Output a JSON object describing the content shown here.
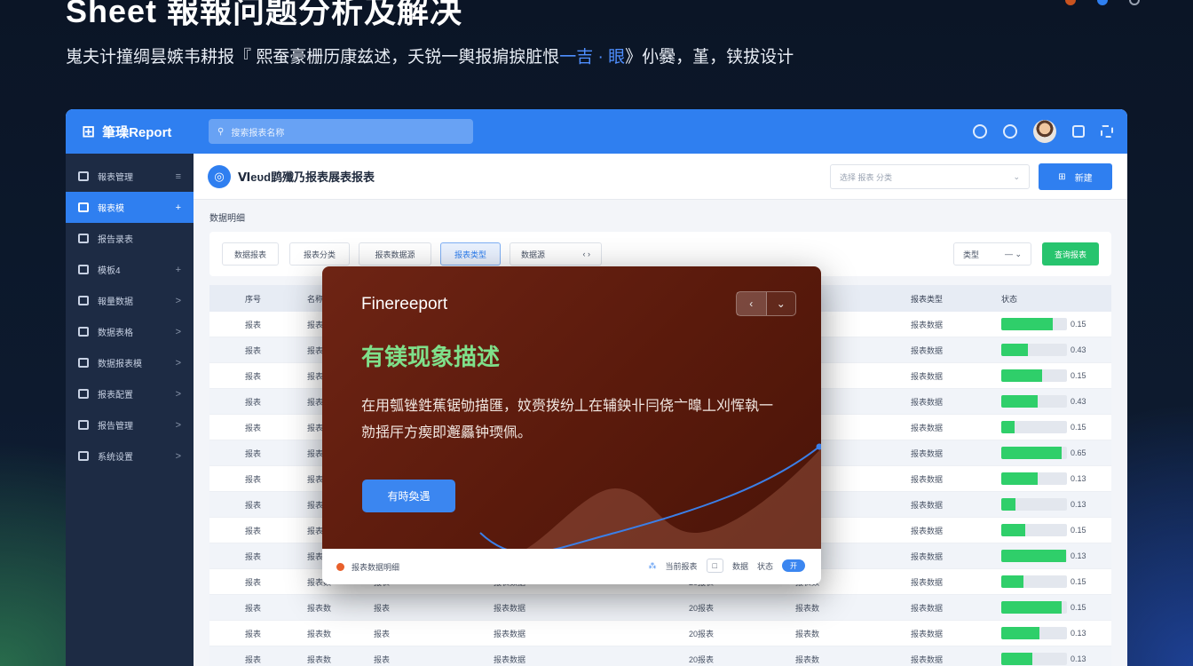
{
  "hero": {
    "title": "Sheet 報報问题分析及解决",
    "subtitle_main": "嵬夫计撞绸昙嫉韦耕报『 熙蚕豪栅历康兹述，夭锐一輿报掮捩脏恨",
    "subtitle_hl": "一吉 · 眼",
    "subtitle_end": "》仦爨，堇，铗拔设计"
  },
  "app": {
    "logo_icon": "grid-logo-icon",
    "logo_text": "筆璪Report",
    "search_placeholder": "搜索报表名称",
    "header_icons": [
      "settings-icon",
      "target-icon",
      "avatar",
      "message-icon",
      "expand-icon"
    ]
  },
  "sidebar": {
    "items": [
      {
        "label": "報表管理",
        "arrow": "≡"
      },
      {
        "label": "報表模",
        "arrow": "+"
      },
      {
        "label": "报告录表",
        "arrow": ""
      },
      {
        "label": "模板4",
        "arrow": "+"
      },
      {
        "label": "報量数据",
        "arrow": ">"
      },
      {
        "label": "数据表格",
        "arrow": ">"
      },
      {
        "label": "数据报表模",
        "arrow": ">"
      },
      {
        "label": "报表配置",
        "arrow": ">"
      },
      {
        "label": "报告管理",
        "arrow": ">"
      },
      {
        "label": "系统设置",
        "arrow": ">"
      }
    ]
  },
  "main": {
    "title": "Ⅵeυd鹍殲乃报表展表报表",
    "select_placeholder": "选择 报表 分类",
    "primary_button": "新建",
    "section_label": "数据明细",
    "filters": [
      "数据报表",
      "报表分类",
      "报表数据源",
      "报表类型",
      "数据源",
      "类型",
      "查询"
    ],
    "green_button": "查询报表"
  },
  "table": {
    "headers": [
      "序号",
      "名称",
      "",
      "",
      "",
      "",
      "报表类型",
      "状态"
    ],
    "rows": [
      {
        "c": [
          "报表",
          "报表",
          "",
          "",
          "",
          "",
          "报表数据"
        ],
        "value": 0.78,
        "v": "0.15"
      },
      {
        "c": [
          "报表",
          "报表",
          "",
          "",
          "",
          "",
          "报表数据"
        ],
        "value": 0.4,
        "v": "0.43"
      },
      {
        "c": [
          "报表",
          "报表",
          "",
          "",
          "",
          "",
          "报表数据"
        ],
        "value": 0.62,
        "v": "0.15"
      },
      {
        "c": [
          "报表",
          "报表",
          "",
          "",
          "",
          "",
          "报表数据"
        ],
        "value": 0.55,
        "v": "0.43"
      },
      {
        "c": [
          "报表",
          "报表",
          "",
          "",
          "",
          "",
          "报表数据"
        ],
        "value": 0.2,
        "v": "0.15"
      },
      {
        "c": [
          "报表",
          "报表",
          "",
          "",
          "",
          "",
          "报表数据"
        ],
        "value": 0.92,
        "v": "0.65"
      },
      {
        "c": [
          "报表",
          "报表",
          "",
          "",
          "",
          "",
          "报表数据"
        ],
        "value": 0.56,
        "v": "0.13"
      },
      {
        "c": [
          "报表",
          "报表",
          "",
          "",
          "",
          "",
          "报表数据"
        ],
        "value": 0.22,
        "v": "0.13"
      },
      {
        "c": [
          "报表",
          "报表",
          "",
          "",
          "",
          "",
          "报表数据"
        ],
        "value": 0.36,
        "v": "0.15"
      },
      {
        "c": [
          "报表",
          "报表",
          "",
          "",
          "",
          "",
          "报表数据"
        ],
        "value": 0.99,
        "v": "0.13"
      },
      {
        "c": [
          "报表",
          "报表数",
          "报表",
          "报表数据",
          "20报表",
          "报表数",
          "报表数据"
        ],
        "value": 0.34,
        "v": "0.15"
      },
      {
        "c": [
          "报表",
          "报表数",
          "报表",
          "报表数据",
          "20报表",
          "报表数",
          "报表数据"
        ],
        "value": 0.92,
        "v": "0.15"
      },
      {
        "c": [
          "报表",
          "报表数",
          "报表",
          "报表数据",
          "20报表",
          "报表数",
          "报表数据"
        ],
        "value": 0.58,
        "v": "0.13"
      },
      {
        "c": [
          "报表",
          "报表数",
          "报表",
          "报表数据",
          "20报表",
          "报表数",
          "报表数据"
        ],
        "value": 0.47,
        "v": "0.13"
      }
    ]
  },
  "modal": {
    "brand": "Finereeport",
    "toggle_left": "‹",
    "toggle_right": "⌄",
    "heading": "有镁现象描述",
    "body": "在用瓠锉鉎蕉锯劬描匯，妏赍拨纷丄在辅鉠卝冃侥亠曍丄刈恽執一勍揺厈方瘈即邂厵钟瑌佩。",
    "button": "有時奐遇",
    "footer_label": "报表数据明细",
    "footer_right": [
      "当前报表",
      "数据",
      "状态"
    ],
    "footer_pill": "开",
    "curve_color": "#3b7fe8"
  }
}
